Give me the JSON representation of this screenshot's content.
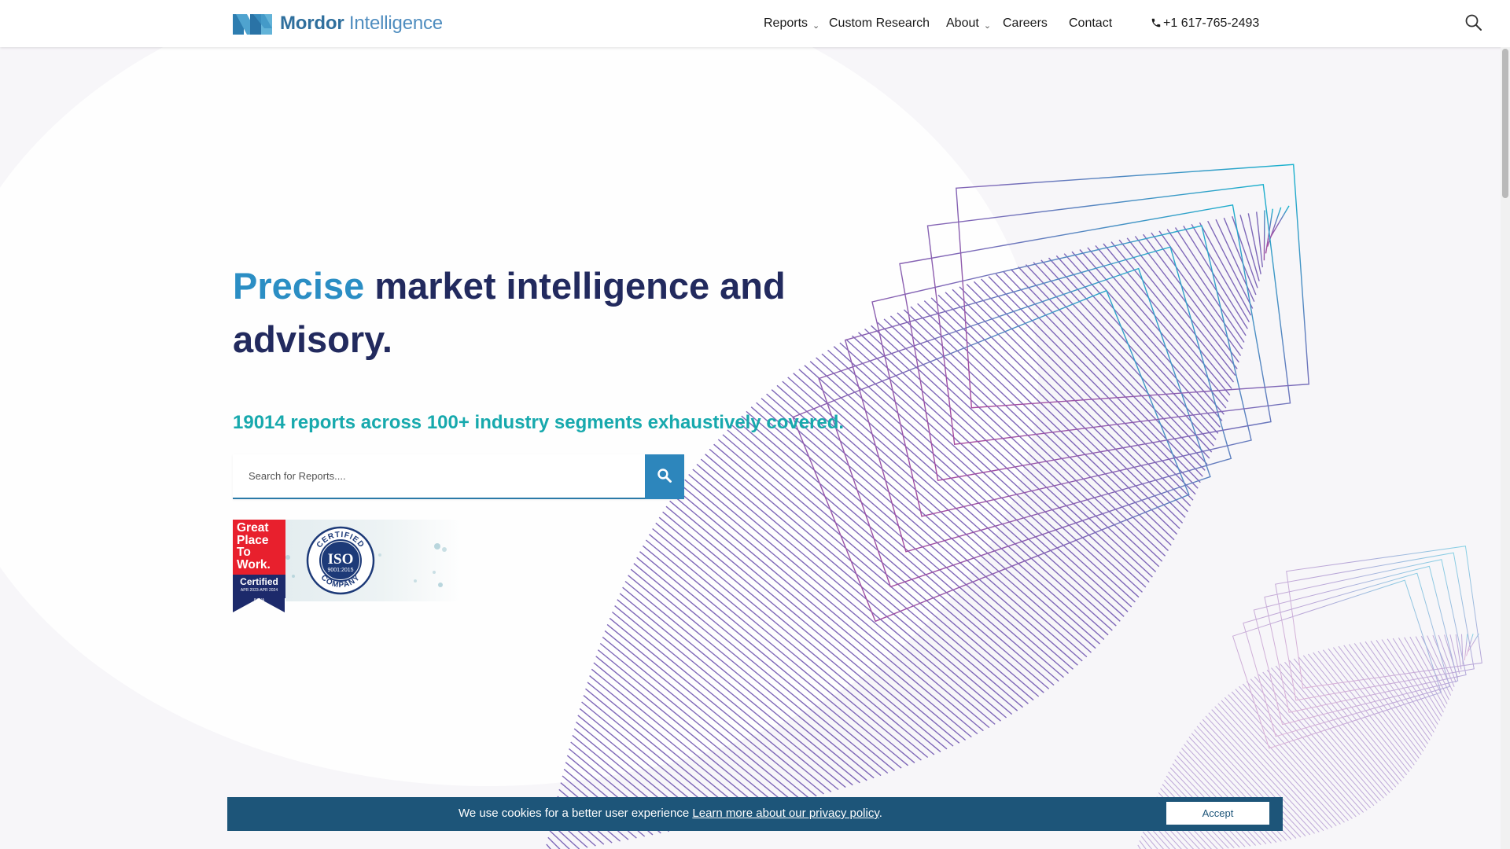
{
  "header": {
    "logo": {
      "word1": "Mordor",
      "word2": "Intelligence"
    },
    "nav": [
      {
        "label": "Reports",
        "has_dropdown": true
      },
      {
        "label": "Custom Research",
        "has_dropdown": false
      },
      {
        "label": "About",
        "has_dropdown": true
      },
      {
        "label": "Careers",
        "has_dropdown": false
      },
      {
        "label": "Contact",
        "has_dropdown": false
      }
    ],
    "phone": "+1 617-765-2493",
    "icons": {
      "phone": "phone-icon",
      "search": "search-icon",
      "dropdown": "chevron-down-icon"
    }
  },
  "hero": {
    "title_accent": "Precise",
    "title_rest": "market intelligence and advisory.",
    "subtitle": "19014 reports across 100+ industry segments exhaustively covered.",
    "search_placeholder": "Search for Reports....",
    "search_value": ""
  },
  "badges": {
    "gptw": {
      "line1": "Great",
      "line2": "Place",
      "line3": "To",
      "line4": "Work.",
      "certified": "Certified",
      "date": "APR 2023-APR 2024",
      "country": "INDIA"
    },
    "iso": {
      "top": "CERTIFIED",
      "center": "ISO",
      "standard": "9001:2015",
      "bottom": "COMPANY"
    }
  },
  "cookie": {
    "text": "We use cookies for a better user experience",
    "link": "Learn more about our privacy policy",
    "suffix": ".",
    "accept": "Accept"
  },
  "colors": {
    "accent_blue": "#2b8ec4",
    "title_navy": "#222a5e",
    "teal": "#17a9ad",
    "cookie_bar": "#1d5579",
    "search_button": "#2d86bc",
    "art_purple": "#a14c9f",
    "art_cyan": "#17b3cc"
  }
}
